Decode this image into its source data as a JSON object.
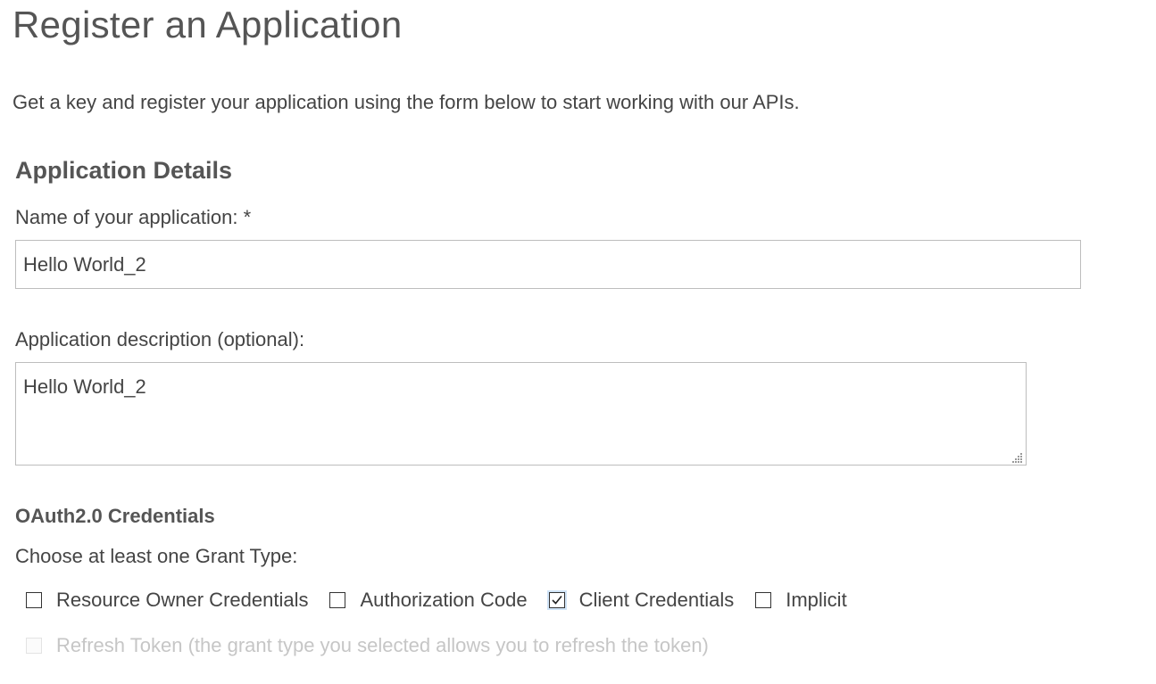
{
  "page": {
    "title": "Register an Application",
    "intro": "Get a key and register your application using the form below to start working with our APIs."
  },
  "details": {
    "section_title": "Application Details",
    "name_label": "Name of your application: *",
    "name_value": "Hello World_2",
    "description_label": "Application description (optional):",
    "description_value": "Hello World_2"
  },
  "oauth": {
    "section_title": "OAuth2.0 Credentials",
    "grant_label": "Choose at least one Grant Type:",
    "grant_types": [
      {
        "label": "Resource Owner Credentials",
        "checked": false
      },
      {
        "label": "Authorization Code",
        "checked": false
      },
      {
        "label": "Client Credentials",
        "checked": true
      },
      {
        "label": "Implicit",
        "checked": false
      }
    ],
    "refresh_token": {
      "label": "Refresh Token (the grant type you selected allows you to refresh the token)",
      "checked": false,
      "disabled": true
    }
  },
  "icons": {
    "checkmark": "check-icon",
    "resize": "resize-grip-icon"
  }
}
